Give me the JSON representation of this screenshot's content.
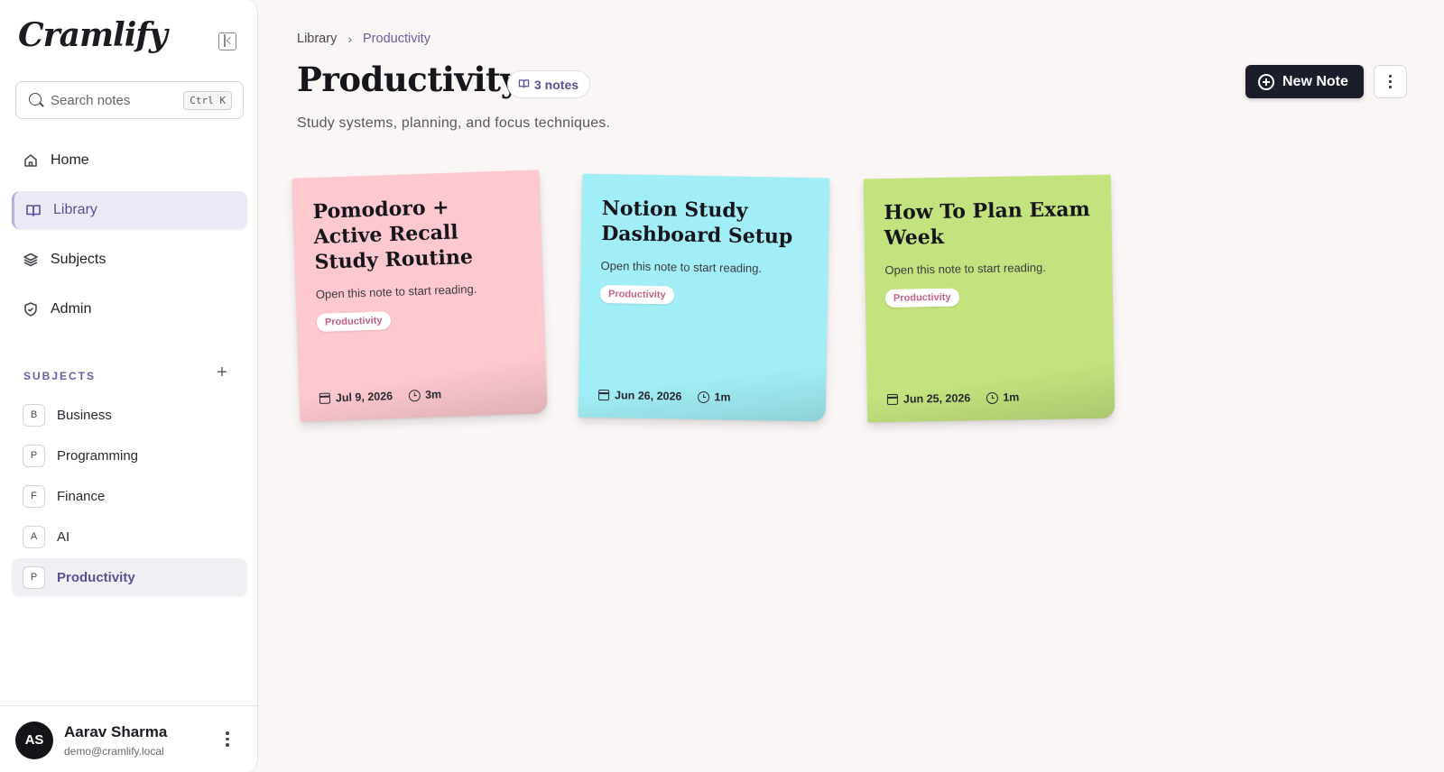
{
  "app": {
    "logo": "Cramlify"
  },
  "search": {
    "placeholder": "Search notes",
    "shortcut": "Ctrl K"
  },
  "nav": [
    {
      "label": "Home",
      "icon": "home-icon"
    },
    {
      "label": "Library",
      "icon": "book-open-icon",
      "active": true
    },
    {
      "label": "Subjects",
      "icon": "layers-icon"
    },
    {
      "label": "Admin",
      "icon": "shield-icon"
    }
  ],
  "subjects": {
    "title": "SUBJECTS",
    "add_label": "+",
    "items": [
      {
        "initial": "B",
        "label": "Business"
      },
      {
        "initial": "P",
        "label": "Programming"
      },
      {
        "initial": "F",
        "label": "Finance"
      },
      {
        "initial": "A",
        "label": "AI"
      },
      {
        "initial": "P",
        "label": "Productivity",
        "active": true
      }
    ]
  },
  "user": {
    "initials": "AS",
    "name": "Aarav Sharma",
    "email": "demo@cramlify.local"
  },
  "breadcrumb": {
    "root": "Library",
    "current": "Productivity"
  },
  "page": {
    "title": "Productivity",
    "count_label": "3 notes",
    "subtitle": "Study systems, planning, and focus techniques.",
    "new_note_label": "New Note"
  },
  "notes": [
    {
      "title": "Pomodoro + Active Recall Study Routine",
      "excerpt": "Open this note to start reading.",
      "tag": "Productivity",
      "date": "Jul 9, 2026",
      "read_time": "3m",
      "color": "#fdc8cf"
    },
    {
      "title": "Notion Study Dashboard Setup",
      "excerpt": "Open this note to start reading.",
      "tag": "Productivity",
      "date": "Jun 26, 2026",
      "read_time": "1m",
      "color": "#a2eef6"
    },
    {
      "title": "How To Plan Exam Week",
      "excerpt": "Open this note to start reading.",
      "tag": "Productivity",
      "date": "Jun 25, 2026",
      "read_time": "1m",
      "color": "#c3e37e"
    }
  ],
  "colors": {
    "accent": "#6a5da0",
    "primary_button": "#1b1d2b",
    "tag_text": "#c0628a"
  }
}
